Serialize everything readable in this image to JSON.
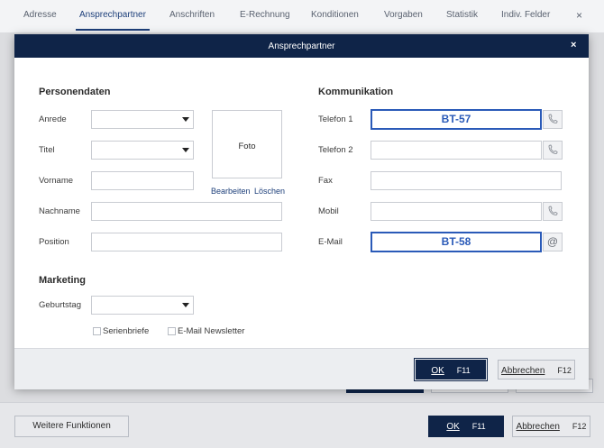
{
  "tabs": [
    {
      "label": "Adresse"
    },
    {
      "label": "Ansprechpartner"
    },
    {
      "label": "Anschriften"
    },
    {
      "label": "E-Rechnung"
    },
    {
      "label": "Konditionen"
    },
    {
      "label": "Vorgaben"
    },
    {
      "label": "Statistik"
    },
    {
      "label": "Indiv. Felder"
    }
  ],
  "tab_close": "×",
  "active_tab": "Ansprechpartner",
  "background": {
    "weitere_label": "Weitere Funktionen",
    "ok_label": "OK",
    "ok_key": "F11",
    "cancel_label": "Abbrechen",
    "cancel_key": "F12"
  },
  "dialog": {
    "title": "Ansprechpartner",
    "close": "×",
    "personendaten": {
      "heading": "Personendaten",
      "anrede_label": "Anrede",
      "titel_label": "Titel",
      "vorname_label": "Vorname",
      "nachname_label": "Nachname",
      "position_label": "Position"
    },
    "photo": {
      "label": "Foto",
      "edit_link": "Bearbeiten",
      "delete_link": "Löschen"
    },
    "kommunikation": {
      "heading": "Kommunikation",
      "telefon1_label": "Telefon 1",
      "telefon1_value": "BT-57",
      "telefon2_label": "Telefon 2",
      "fax_label": "Fax",
      "mobil_label": "Mobil",
      "email_label": "E-Mail",
      "email_value": "BT-58"
    },
    "marketing": {
      "heading": "Marketing",
      "geburtstag_label": "Geburtstag",
      "serienbriefe_label": "Serienbriefe",
      "newsletter_label": "E-Mail Newsletter"
    },
    "footer": {
      "ok_label": "OK",
      "ok_key": "F11",
      "cancel_label": "Abbrechen",
      "cancel_key": "F12"
    }
  },
  "colors": {
    "primary": "#0f2448",
    "highlight": "#2a5ab8"
  }
}
